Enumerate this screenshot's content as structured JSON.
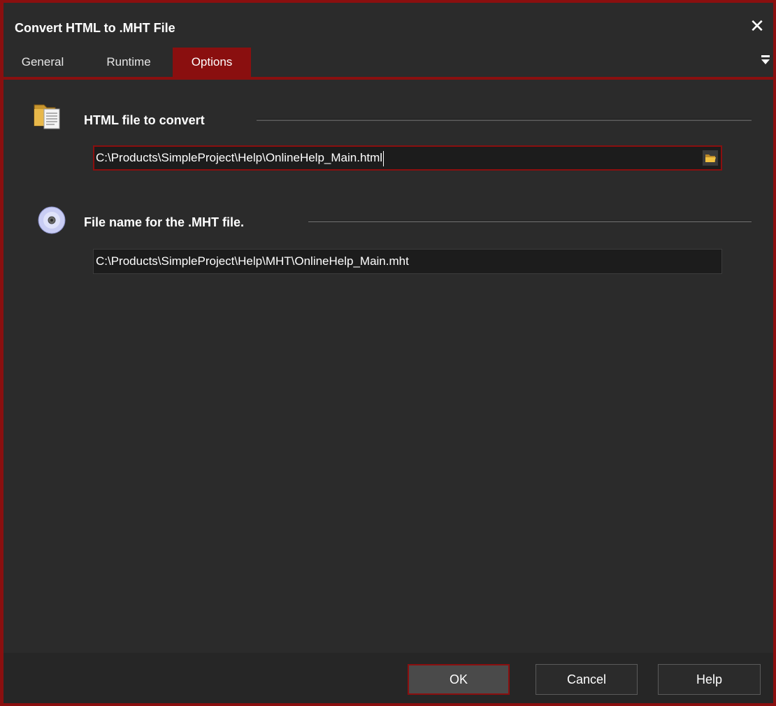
{
  "window": {
    "title": "Convert HTML to .MHT File"
  },
  "tabs": [
    {
      "label": "General"
    },
    {
      "label": "Runtime"
    },
    {
      "label": "Options"
    }
  ],
  "active_tab": "Options",
  "sections": {
    "html_file": {
      "label": "HTML file to convert",
      "value": "C:\\Products\\SimpleProject\\Help\\OnlineHelp_Main.html",
      "icon": "documents-icon"
    },
    "mht_file": {
      "label": "File name for the .MHT file.",
      "value": "C:\\Products\\SimpleProject\\Help\\MHT\\OnlineHelp_Main.mht",
      "icon": "disc-icon"
    }
  },
  "buttons": {
    "ok": "OK",
    "cancel": "Cancel",
    "help": "Help"
  },
  "colors": {
    "accent": "#8a0f0f",
    "background": "#2b2b2b",
    "field_background": "#1c1c1c"
  }
}
